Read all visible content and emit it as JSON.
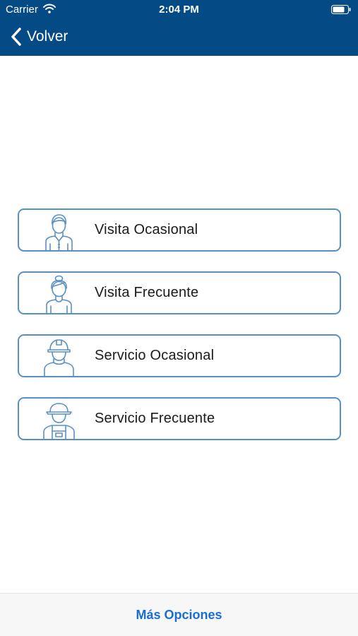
{
  "status_bar": {
    "carrier": "Carrier",
    "time": "2:04 PM"
  },
  "nav": {
    "back_label": "Volver"
  },
  "options": [
    {
      "label": "Visita Ocasional",
      "icon": "man-icon"
    },
    {
      "label": "Visita Frecuente",
      "icon": "woman-icon"
    },
    {
      "label": "Servicio Ocasional",
      "icon": "construction-worker-icon"
    },
    {
      "label": "Servicio Frecuente",
      "icon": "technician-icon"
    }
  ],
  "footer": {
    "more_label": "Más Opciones"
  },
  "colors": {
    "header": "#044a85",
    "border": "#5b8fc4",
    "link": "#1b6cd3"
  }
}
